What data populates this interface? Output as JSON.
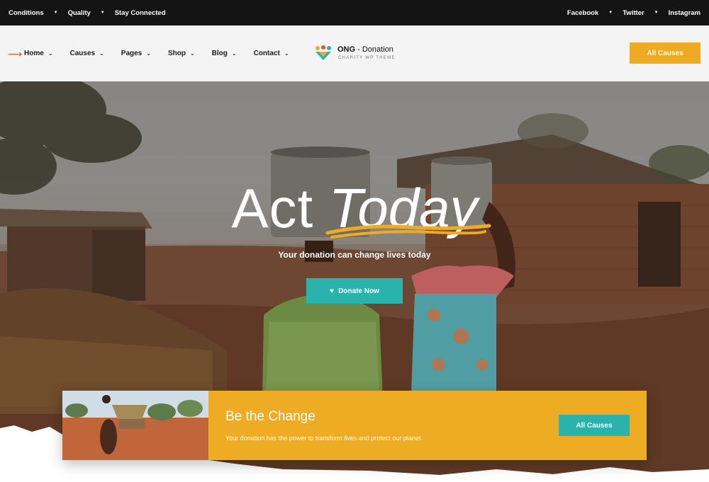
{
  "topbar": {
    "left_links": [
      "Conditions",
      "Quality",
      "Stay Connected"
    ],
    "right_links": [
      "Facebook",
      "Twitter",
      "Instagram"
    ]
  },
  "nav": {
    "items": [
      {
        "label": "Home"
      },
      {
        "label": "Causes"
      },
      {
        "label": "Pages"
      },
      {
        "label": "Shop"
      },
      {
        "label": "Blog"
      },
      {
        "label": "Contact"
      }
    ],
    "cta_label": "All Causes"
  },
  "logo": {
    "name_bold": "ONG",
    "name_rest": " - Donation",
    "tagline": "CHARITY WP THEME"
  },
  "hero": {
    "title_word1": "Act",
    "title_word2": "Today",
    "subtitle": "Your donation can change lives today",
    "donate_label": "Donate Now"
  },
  "card": {
    "title": "Be the Change",
    "text": "Your donation has the power to transform lives and protect our planet.",
    "button_label": "All Causes"
  },
  "colors": {
    "accent_yellow": "#eeab24",
    "accent_teal": "#2ab2ad",
    "topbar_bg": "#141414",
    "arrow_red": "#e2533b"
  },
  "icons": [
    "arrow-right-icon",
    "chevron-down-icon",
    "heart-icon",
    "logo-people-icon"
  ]
}
